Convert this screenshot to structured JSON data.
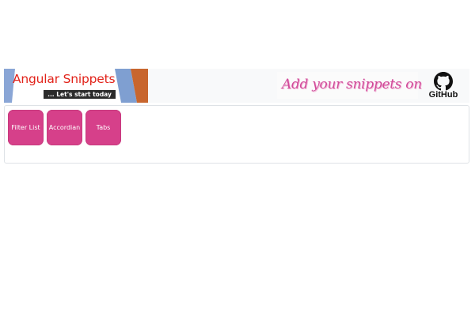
{
  "header": {
    "logo": {
      "title": "Angular Snippets",
      "tagline": "... Let's start today"
    },
    "promo_text": "Add your snippets on",
    "github_label": "GitHub"
  },
  "nav": {
    "items": [
      {
        "label": "Filter List"
      },
      {
        "label": "Accordian"
      },
      {
        "label": "Tabs"
      }
    ]
  },
  "colors": {
    "tile": "#d6408a",
    "logo_red": "#e2231a",
    "promo_pink": "#d14b9a",
    "header_bg": "#f8f9fa"
  },
  "icons": {
    "github": "github-octocat-icon"
  }
}
